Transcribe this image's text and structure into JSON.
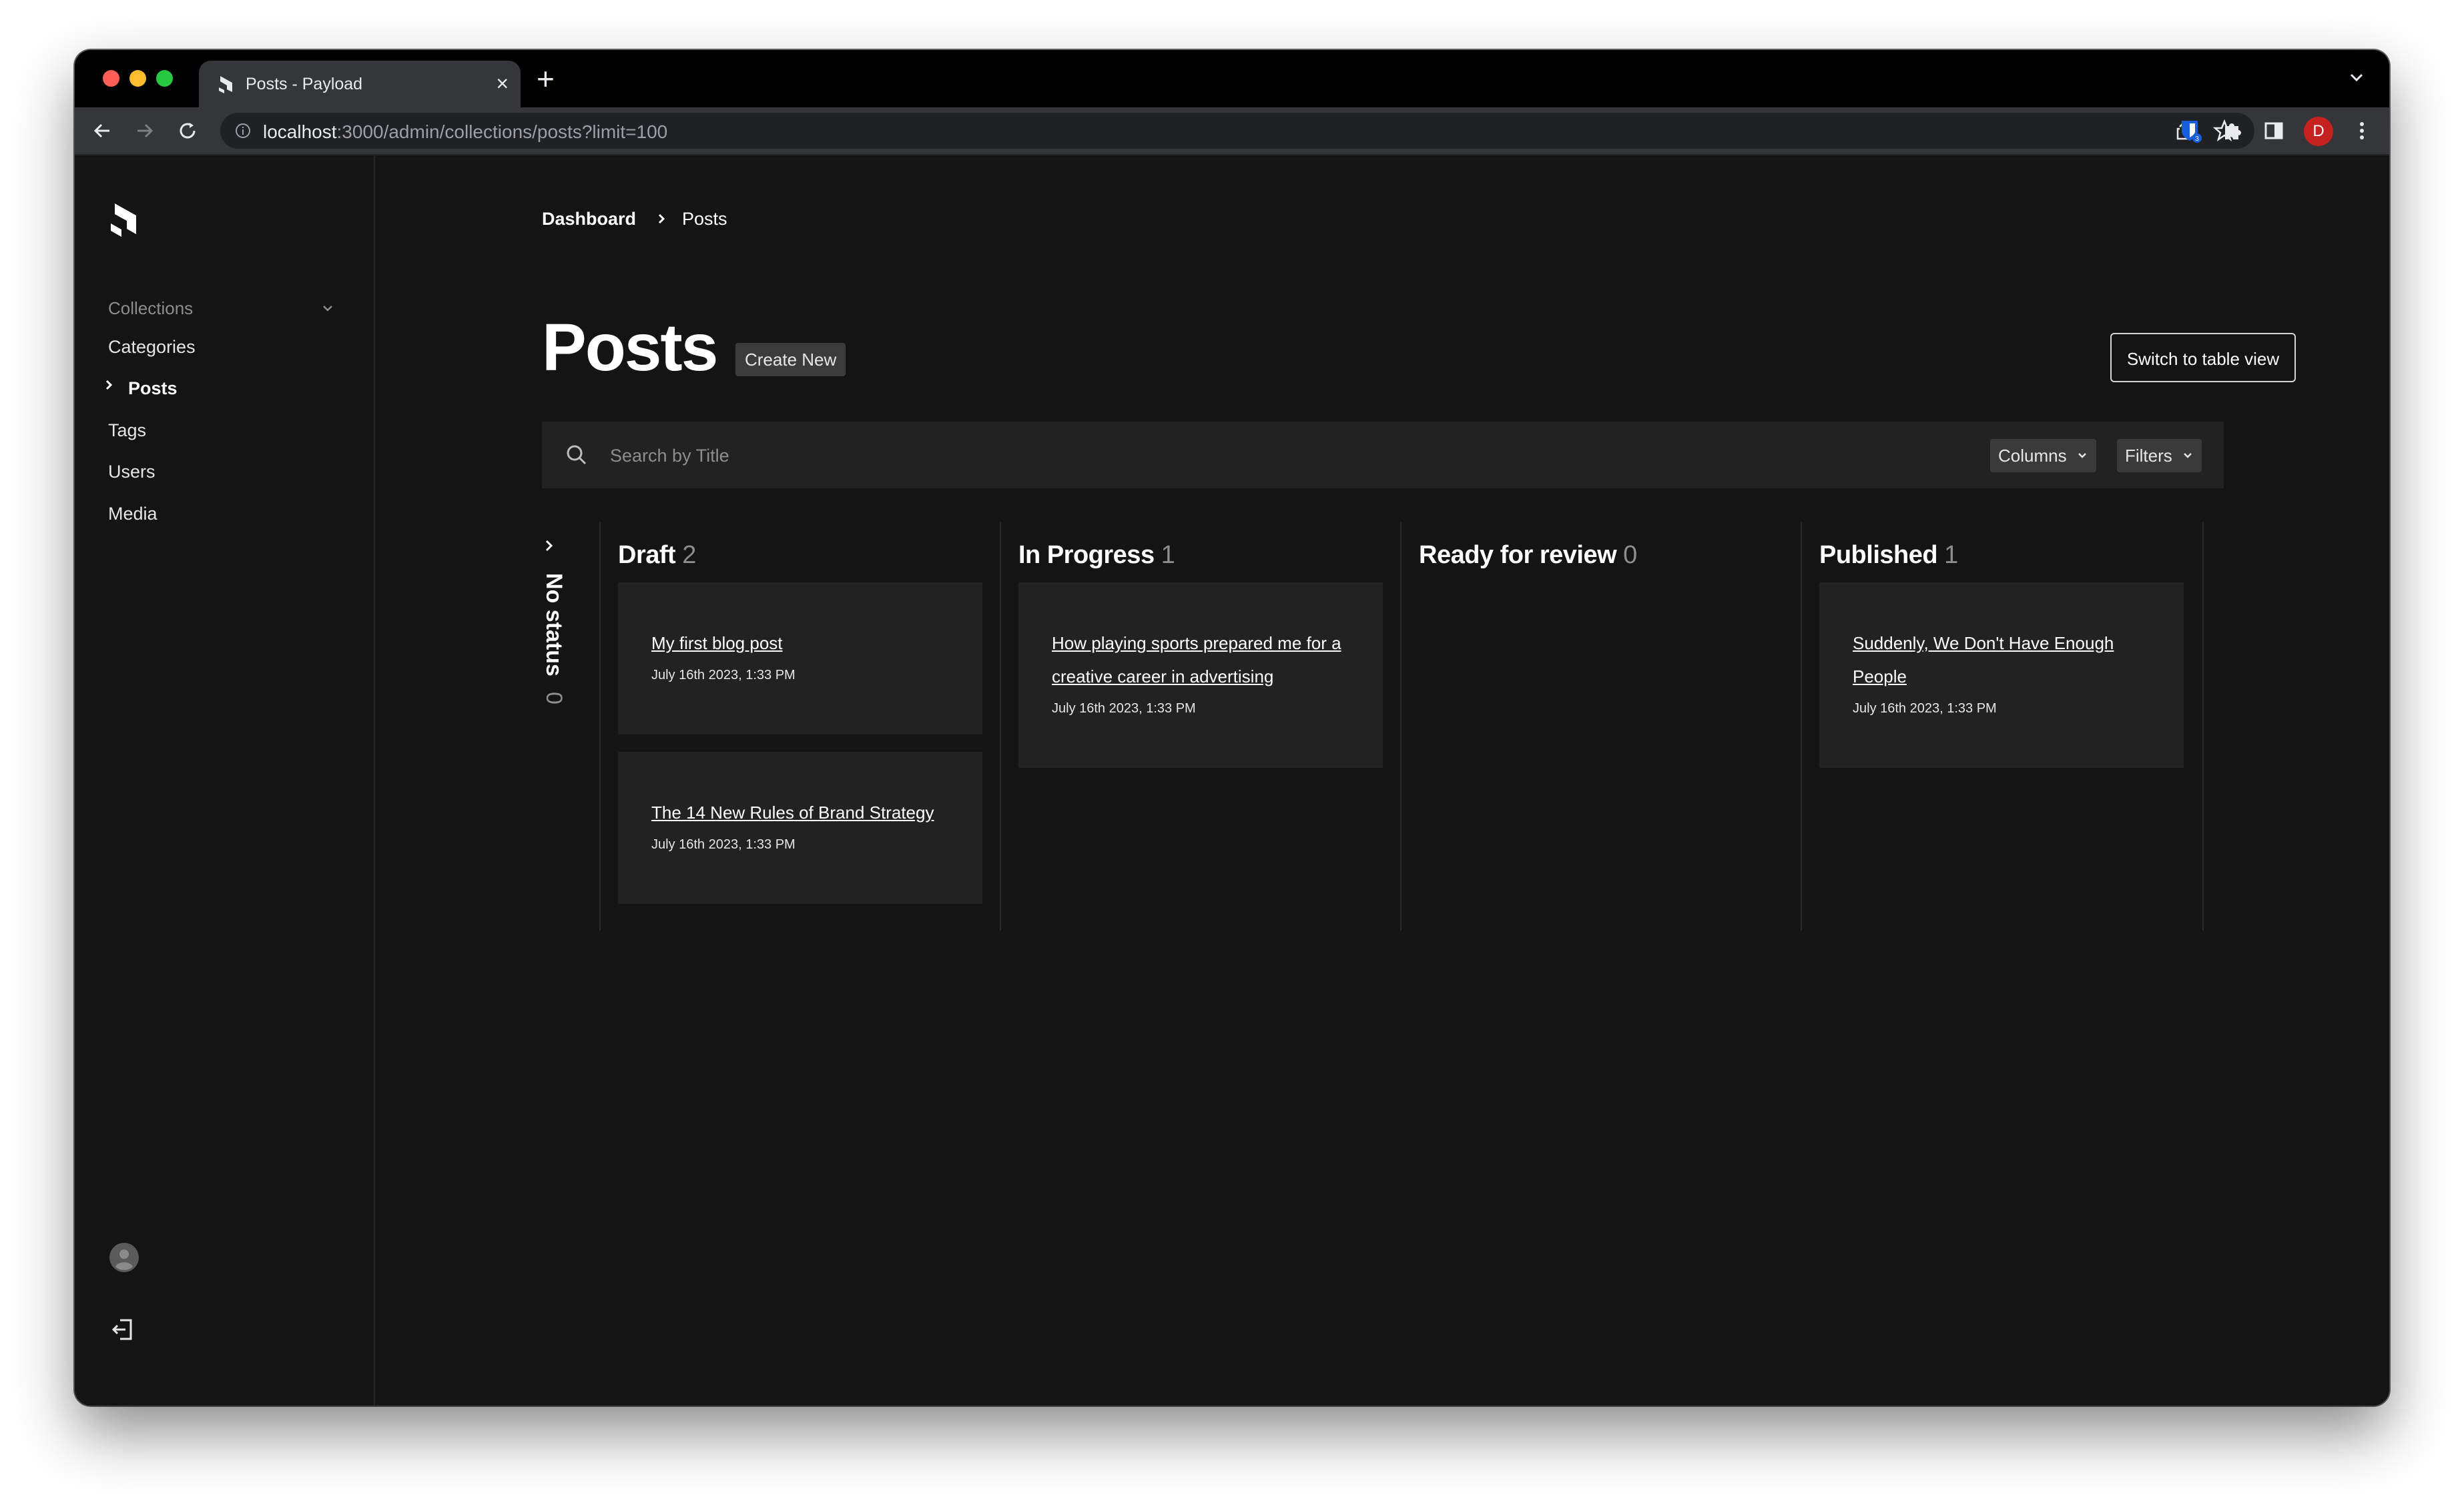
{
  "browser": {
    "tab_title": "Posts - Payload",
    "tab_close": "×",
    "new_tab": "+",
    "url_host": "localhost",
    "url_rest": ":3000/admin/collections/posts?limit=100",
    "extension_badge": "3",
    "profile_initial": "D"
  },
  "sidebar": {
    "group_label": "Collections",
    "items": [
      {
        "label": "Categories"
      },
      {
        "label": "Posts"
      },
      {
        "label": "Tags"
      },
      {
        "label": "Users"
      },
      {
        "label": "Media"
      }
    ],
    "active_item": "Posts"
  },
  "breadcrumb": {
    "root": "Dashboard",
    "current": "Posts"
  },
  "page": {
    "title": "Posts",
    "create_new_label": "Create New",
    "switch_view_label": "Switch to table view"
  },
  "search": {
    "placeholder": "Search by Title",
    "value": "",
    "columns_label": "Columns",
    "filters_label": "Filters"
  },
  "board": {
    "no_status": {
      "label": "No status",
      "count": "0"
    },
    "columns": [
      {
        "title": "Draft",
        "count": "2",
        "cards": [
          {
            "title": "My first blog post",
            "date": "July 16th 2023, 1:33 PM"
          },
          {
            "title": "The 14 New Rules of Brand Strategy",
            "date": "July 16th 2023, 1:33 PM"
          }
        ]
      },
      {
        "title": "In Progress",
        "count": "1",
        "cards": [
          {
            "title": "How playing sports prepared me for a creative career in advertising",
            "date": "July 16th 2023, 1:33 PM"
          }
        ]
      },
      {
        "title": "Ready for review",
        "count": "0",
        "cards": []
      },
      {
        "title": "Published",
        "count": "1",
        "cards": [
          {
            "title": "Suddenly, We Don't Have Enough People",
            "date": "July 16th 2023, 1:33 PM"
          }
        ]
      }
    ]
  },
  "colors": {
    "background": "#141414",
    "card": "#222222",
    "text": "#ffffff",
    "muted": "#8d8d8d",
    "avatar": "#c5221f"
  }
}
